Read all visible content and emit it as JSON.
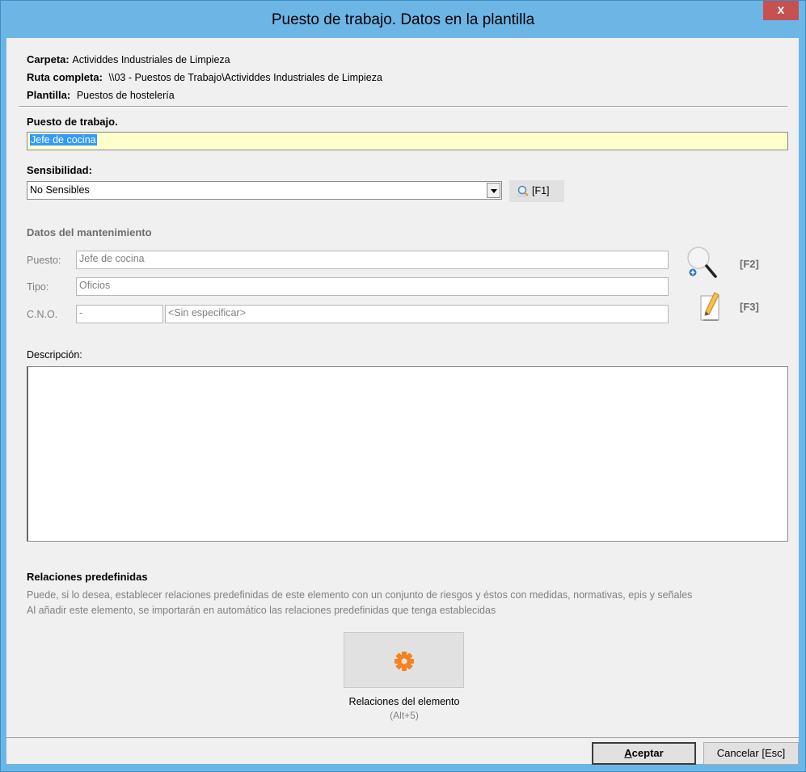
{
  "window": {
    "title": "Puesto de trabajo. Datos en la plantilla",
    "close_label": "x"
  },
  "info": {
    "carpeta_label": "Carpeta:",
    "carpeta_value": "Actividdes Industriales de Limpieza",
    "ruta_label": "Ruta completa:",
    "ruta_value": "\\\\03 - Puestos de Trabajo\\Actividdes Industriales de Limpieza",
    "plantilla_label": "Plantilla:",
    "plantilla_value": "Puestos de hostelería"
  },
  "puesto": {
    "label": "Puesto de trabajo.",
    "value": "Jefe de cocina"
  },
  "sensibilidad": {
    "label": "Sensibilidad:",
    "value": "No Sensibles",
    "f1_label": "[F1]"
  },
  "mantenimiento": {
    "title": "Datos del mantenimiento",
    "puesto_label": "Puesto:",
    "puesto_value": "Jefe de cocina",
    "tipo_label": "Tipo:",
    "tipo_value": "Oficios",
    "cno_label": "C.N.O.",
    "cno_code": "-",
    "cno_desc": "<Sin especificar>",
    "f2_label": "[F2]",
    "f3_label": "[F3]"
  },
  "descripcion": {
    "label": "Descripción:"
  },
  "relaciones": {
    "title": "Relaciones predefinidas",
    "line1": "Puede, si lo desea, establecer relaciones predefinidas de este elemento con un conjunto de riesgos y éstos con medidas, normativas, epis y señales",
    "line2": "Al añadir este elemento, se importarán en automático las relaciones predefinidas que tenga establecidas",
    "button_label": "Relaciones del elemento",
    "button_shortcut": "(Alt+5)",
    "accent": "#f58220"
  },
  "footer": {
    "aceptar_label": "ceptar",
    "aceptar_mnemonic": "A",
    "cancelar_label": "Cancelar [Esc]"
  }
}
